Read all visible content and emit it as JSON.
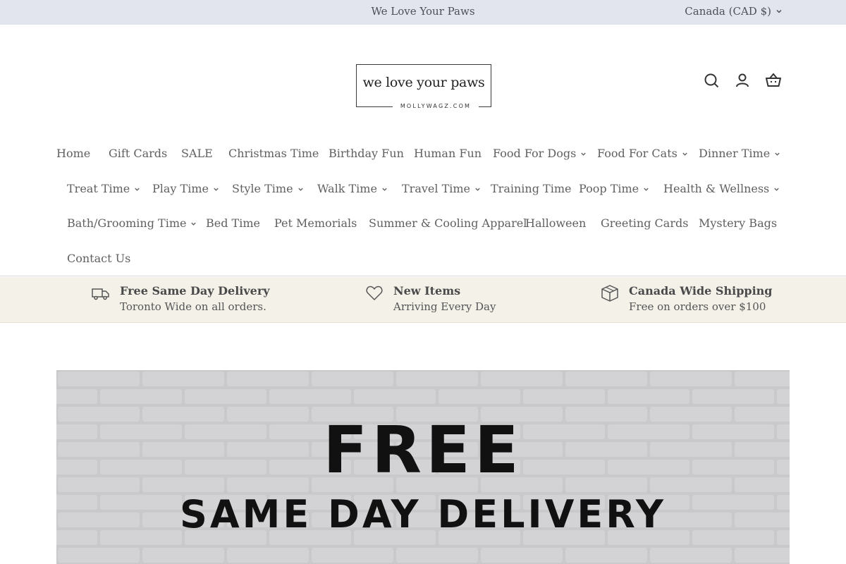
{
  "announcement": {
    "message": "We Love Your Paws",
    "currency": "Canada (CAD $)"
  },
  "logo": {
    "line1": "we love your paws",
    "line2": "MOLLYWAGZ.COM"
  },
  "header_icons": [
    "search-icon",
    "account-icon",
    "cart-icon"
  ],
  "nav": {
    "row1": [
      {
        "label": "Home",
        "dropdown": false
      },
      {
        "label": "Gift Cards",
        "dropdown": false
      },
      {
        "label": "SALE",
        "dropdown": false
      },
      {
        "label": "Christmas Time",
        "dropdown": false
      },
      {
        "label": "Birthday Fun",
        "dropdown": false
      },
      {
        "label": "Human Fun",
        "dropdown": false
      },
      {
        "label": "Food For Dogs",
        "dropdown": true
      },
      {
        "label": "Food For Cats",
        "dropdown": true
      },
      {
        "label": "Dinner Time",
        "dropdown": true
      }
    ],
    "row2": [
      {
        "label": "Treat Time",
        "dropdown": true
      },
      {
        "label": "Play Time",
        "dropdown": true
      },
      {
        "label": "Style Time",
        "dropdown": true
      },
      {
        "label": "Walk Time",
        "dropdown": true
      },
      {
        "label": "Travel Time",
        "dropdown": true
      },
      {
        "label": "Training Time",
        "dropdown": false
      },
      {
        "label": "Poop Time",
        "dropdown": true
      },
      {
        "label": "Health & Wellness",
        "dropdown": true
      }
    ],
    "row3": [
      {
        "label": "Bath/Grooming Time",
        "dropdown": true
      },
      {
        "label": "Bed Time",
        "dropdown": false
      },
      {
        "label": "Pet Memorials",
        "dropdown": false
      },
      {
        "label": "Summer & Cooling Apparel",
        "dropdown": false
      },
      {
        "label": "Halloween",
        "dropdown": false
      },
      {
        "label": "Greeting Cards",
        "dropdown": false
      },
      {
        "label": "Mystery Bags",
        "dropdown": false
      }
    ],
    "row4": [
      {
        "label": "Contact Us",
        "dropdown": false
      }
    ]
  },
  "features": [
    {
      "icon": "delivery-truck-icon",
      "title": "Free Same Day Delivery",
      "subtitle": "Toronto Wide on all orders."
    },
    {
      "icon": "heart-icon",
      "title": "New Items",
      "subtitle": "Arriving Every Day"
    },
    {
      "icon": "box-icon",
      "title": "Canada Wide Shipping",
      "subtitle": "Free on orders over $100"
    }
  ],
  "hero": {
    "line1": "FREE",
    "line2": "SAME DAY DELIVERY"
  }
}
